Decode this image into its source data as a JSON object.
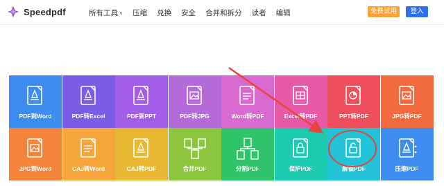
{
  "header": {
    "brand": "Speedpdf",
    "nav": [
      {
        "label": "所有工具",
        "has_dropdown": true
      },
      {
        "label": "压缩"
      },
      {
        "label": "兑换"
      },
      {
        "label": "安全"
      },
      {
        "label": "合并和拆分"
      },
      {
        "label": "读者"
      },
      {
        "label": "编辑"
      }
    ],
    "trial_label": "免费试用",
    "login_label": "登入",
    "brand_color": "#8b4fc9",
    "login_color": "#2f6fe8",
    "trial_color": "#f7a33a"
  },
  "tools": [
    {
      "label": "PDF到Word",
      "color": "#3d8df1",
      "icon": "pdf-to-word-icon"
    },
    {
      "label": "PDF转Excel",
      "color": "#7a5ce6",
      "icon": "pdf-to-excel-icon"
    },
    {
      "label": "PDF到PPT",
      "color": "#a25ee6",
      "icon": "pdf-to-ppt-icon"
    },
    {
      "label": "PDF转JPG",
      "color": "#b46ad9",
      "icon": "pdf-to-jpg-icon"
    },
    {
      "label": "Word转PDF",
      "color": "#d86ad0",
      "icon": "word-to-pdf-icon"
    },
    {
      "label": "Excel转PDF",
      "color": "#e85aa8",
      "icon": "excel-to-pdf-icon"
    },
    {
      "label": "PPT转PDF",
      "color": "#ee4f5b",
      "icon": "ppt-to-pdf-icon"
    },
    {
      "label": "JPG转PDF",
      "color": "#f26a3e",
      "icon": "jpg-to-pdf-icon"
    },
    {
      "label": "JPG到Word",
      "color": "#f5843b",
      "icon": "jpg-to-word-icon"
    },
    {
      "label": "CAJ转Word",
      "color": "#f5a63b",
      "icon": "caj-to-word-icon"
    },
    {
      "label": "CAJ转PDF",
      "color": "#e9b833",
      "icon": "caj-to-pdf-icon"
    },
    {
      "label": "合并PDF",
      "color": "#8cc63e",
      "icon": "merge-pdf-icon"
    },
    {
      "label": "分割PDF",
      "color": "#2fc36a",
      "icon": "split-pdf-icon"
    },
    {
      "label": "保护PDF",
      "color": "#1ccab0",
      "icon": "protect-pdf-icon"
    },
    {
      "label": "解锁PDF",
      "color": "#22c3d6",
      "icon": "unlock-pdf-icon"
    },
    {
      "label": "压缩PDF",
      "color": "#3d8df1",
      "icon": "compress-pdf-icon"
    }
  ]
}
